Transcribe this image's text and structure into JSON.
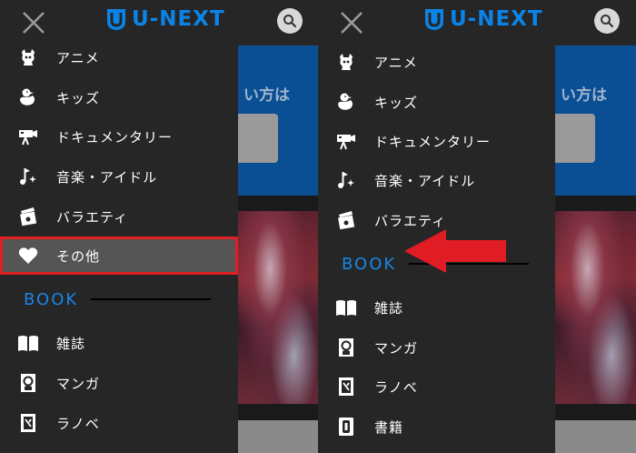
{
  "brand": {
    "logo_text": "U-NEXT",
    "accent": "#0a84e8"
  },
  "background_page": {
    "visible_text": "い方は"
  },
  "menu": {
    "anime": "アニメ",
    "kids": "キッズ",
    "documentary": "ドキュメンタリー",
    "music": "音楽・アイドル",
    "variety": "バラエティ",
    "other": "その他"
  },
  "book": {
    "section_title": "BOOK",
    "magazine": "雑誌",
    "manga": "マンガ",
    "light_novel": "ラノベ",
    "books": "書籍"
  },
  "highlight": {
    "selected_item": "その他",
    "border_color": "#e02020",
    "arrow_color": "#e01c24"
  }
}
